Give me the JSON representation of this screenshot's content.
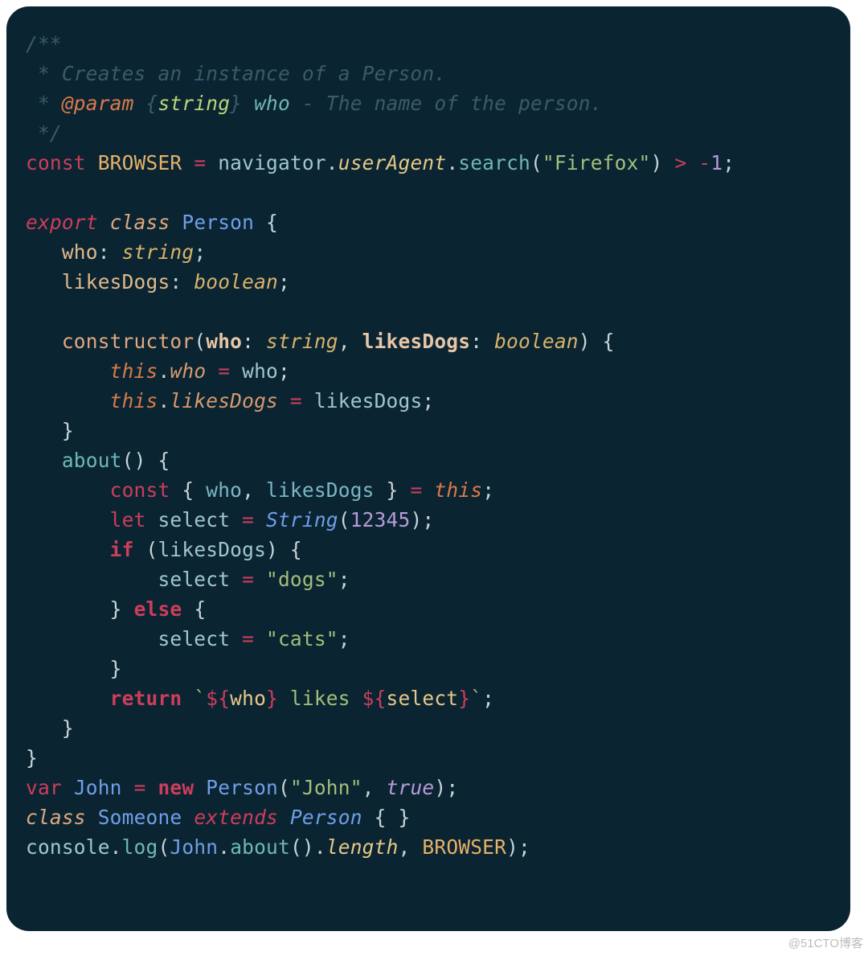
{
  "watermark": "@51CTO博客",
  "code": {
    "comment": {
      "l1": "/**",
      "l2a": " * ",
      "l2b": "Creates an instance of a Person.",
      "l3a": " * ",
      "l3b": "@param",
      "l3c": " {",
      "l3d": "string",
      "l3e": "} ",
      "l3f": "who",
      "l3g": " - The name of the person.",
      "l4": " */"
    },
    "l5": {
      "const": "const",
      "name": "BROWSER",
      "eq": " = ",
      "nav": "navigator",
      "dot1": ".",
      "ua": "userAgent",
      "dot2": ".",
      "search": "search",
      "op": "(",
      "str": "\"Firefox\"",
      "cp": ")",
      "gt": " > ",
      "neg": "-",
      "one": "1",
      "semi": ";"
    },
    "l7": {
      "export": "export",
      "class": "class",
      "name": "Person",
      "ob": " {"
    },
    "l8": {
      "who": "who",
      "colon": ": ",
      "type": "string",
      "semi": ";"
    },
    "l9": {
      "ld": "likesDogs",
      "colon": ": ",
      "type": "boolean",
      "semi": ";"
    },
    "l11": {
      "ctor": "constructor",
      "op": "(",
      "p1": "who",
      "c1": ": ",
      "t1": "string",
      "comma": ", ",
      "p2": "likesDogs",
      "c2": ": ",
      "t2": "boolean",
      "cp": ")",
      "ob": " {"
    },
    "l12": {
      "this": "this",
      "dot": ".",
      "prop": "who",
      "eq": " = ",
      "val": "who",
      "semi": ";"
    },
    "l13": {
      "this": "this",
      "dot": ".",
      "prop": "likesDogs",
      "eq": " = ",
      "val": "likesDogs",
      "semi": ";"
    },
    "l14": {
      "cb": "}"
    },
    "l15": {
      "name": "about",
      "paren": "()",
      "ob": " {"
    },
    "l16": {
      "const": "const",
      "ob": " { ",
      "a": "who",
      "comma": ", ",
      "b": "likesDogs",
      "cb": " } ",
      "eq": "= ",
      "this": "this",
      "semi": ";"
    },
    "l17": {
      "let": "let",
      "sel": "select",
      "eq": " = ",
      "Str": "String",
      "op": "(",
      "num": "12345",
      "cp": ")",
      "semi": ";"
    },
    "l18": {
      "if": "if",
      "op": " (",
      "cond": "likesDogs",
      "cp": ")",
      "ob": " {"
    },
    "l19": {
      "sel": "select",
      "eq": " = ",
      "str": "\"dogs\"",
      "semi": ";"
    },
    "l20": {
      "cb": "} ",
      "else": "else",
      "ob": " {"
    },
    "l21": {
      "sel": "select",
      "eq": " = ",
      "str": "\"cats\"",
      "semi": ";"
    },
    "l22": {
      "cb": "}"
    },
    "l23": {
      "ret": "return",
      "bt1": " `",
      "d1": "${",
      "v1": "who",
      "d1b": "}",
      "mid": " likes ",
      "d2": "${",
      "v2": "select",
      "d2b": "}",
      "bt2": "`",
      "semi": ";"
    },
    "l24": {
      "cb": "}"
    },
    "l25": {
      "cb": "}"
    },
    "l26": {
      "var": "var",
      "name": "John",
      "eq": " = ",
      "new": "new",
      "cls": "Person",
      "op": "(",
      "str": "\"John\"",
      "comma": ", ",
      "bool": "true",
      "cp": ")",
      "semi": ";"
    },
    "l27": {
      "class": "class",
      "name": "Someone",
      "ext": "extends",
      "base": "Person",
      "body": " { }"
    },
    "l28": {
      "console": "console",
      "dot1": ".",
      "log": "log",
      "op": "(",
      "john": "John",
      "dot2": ".",
      "about": "about",
      "paren": "()",
      "dot3": ".",
      "len": "length",
      "comma": ", ",
      "br": "BROWSER",
      "cp": ")",
      "semi": ";"
    }
  }
}
